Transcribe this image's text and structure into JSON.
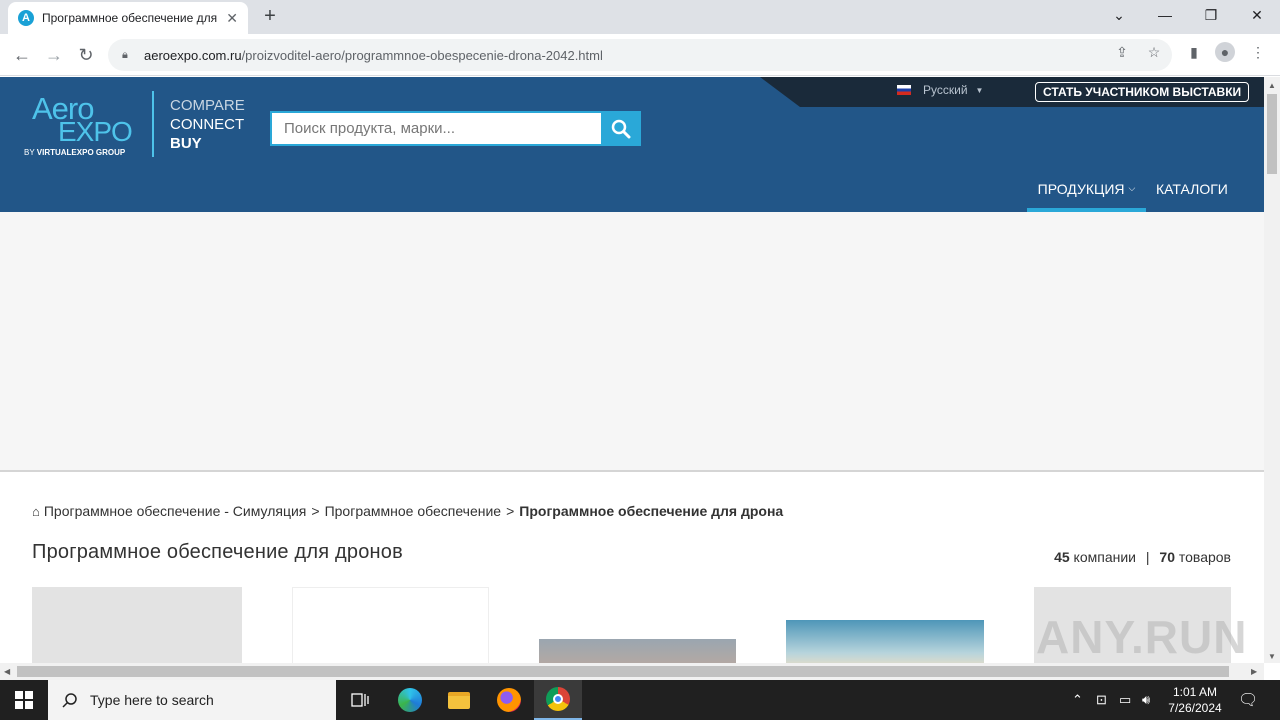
{
  "browser": {
    "tab_title": "Программное обеспечение для дрона",
    "tab_favicon_letter": "A",
    "url_domain": "aeroexpo.com.ru",
    "url_path": "/proizvoditel-aero/programmnoe-obespecenie-drona-2042.html"
  },
  "site": {
    "language": "Русский",
    "exhibit_button": "СТАТЬ УЧАСТНИКОМ ВЫСТАВКИ",
    "logo": {
      "aero": "Aero",
      "expo": "EXPO",
      "by": "BY",
      "group": "VIRTUALEXPO GROUP"
    },
    "tagline": [
      "COMPARE",
      "CONNECT",
      "BUY"
    ],
    "search_placeholder": "Поиск продукта, марки...",
    "nav": {
      "products": "ПРОДУКЦИЯ",
      "catalogs": "КАТАЛОГИ"
    },
    "colors": {
      "header_bg": "#225688",
      "accent": "#2aa8d8",
      "logo": "#4ec3ea"
    }
  },
  "breadcrumb": {
    "items": [
      "Программное обеспечение - Симуляция",
      "Программное обеспечение"
    ],
    "separator": ">",
    "current": "Программное обеспечение для дрона"
  },
  "page": {
    "title": "Программное обеспечение для дронов",
    "companies_count": "45",
    "companies_label": "компании",
    "divider": "|",
    "products_count": "70",
    "products_label": "товаров"
  },
  "watermark": "ANY.RUN",
  "taskbar": {
    "search_placeholder": "Type here to search",
    "time": "1:01 AM",
    "date": "7/26/2024"
  }
}
